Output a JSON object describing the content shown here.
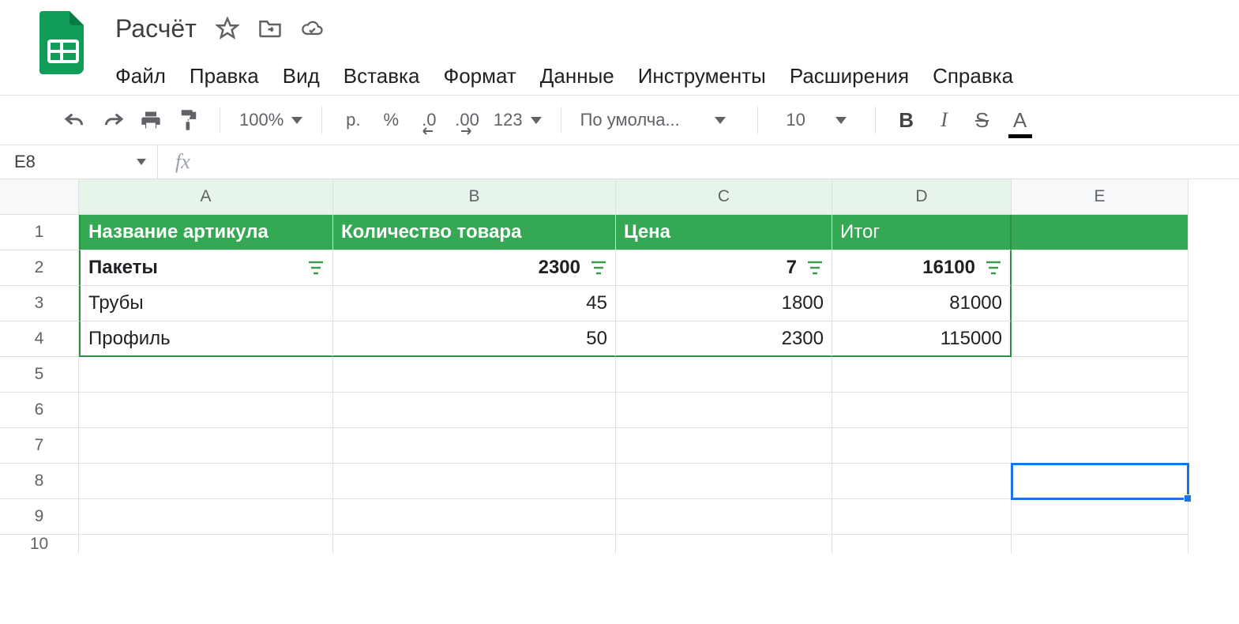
{
  "doc": {
    "title": "Расчёт"
  },
  "menubar": {
    "file": "Файл",
    "edit": "Правка",
    "view": "Вид",
    "insert": "Вставка",
    "format": "Формат",
    "data": "Данные",
    "tools": "Инструменты",
    "extensions": "Расширения",
    "help": "Справка"
  },
  "toolbar": {
    "zoom": "100%",
    "currency": "р.",
    "percent": "%",
    "dec_less": ".0",
    "dec_more": ".00",
    "numfmt": "123",
    "font": "По умолча...",
    "fontsize": "10",
    "bold": "B",
    "italic": "I",
    "strike": "S",
    "textcolor": "A"
  },
  "namebox": "E8",
  "fx": "fx",
  "columns": {
    "A": "A",
    "B": "B",
    "C": "C",
    "D": "D",
    "E": "E"
  },
  "rownums": [
    "1",
    "2",
    "3",
    "4",
    "5",
    "6",
    "7",
    "8",
    "9",
    "10"
  ],
  "headers": {
    "A": "Название артикула",
    "B": "Количество товара",
    "C": "Цена",
    "D": "Итог"
  },
  "rows": [
    {
      "A": "Пакеты",
      "B": "2300",
      "C": "7",
      "D": "16100",
      "bold": true,
      "filter": true
    },
    {
      "A": "Трубы",
      "B": "45",
      "C": "1800",
      "D": "81000"
    },
    {
      "A": "Профиль",
      "B": "50",
      "C": "2300",
      "D": "115000"
    }
  ],
  "selected_cell": "E8",
  "chart_data": {
    "type": "table",
    "columns": [
      "Название артикула",
      "Количество товара",
      "Цена",
      "Итог"
    ],
    "rows": [
      [
        "Пакеты",
        2300,
        7,
        16100
      ],
      [
        "Трубы",
        45,
        1800,
        81000
      ],
      [
        "Профиль",
        50,
        2300,
        115000
      ]
    ]
  }
}
